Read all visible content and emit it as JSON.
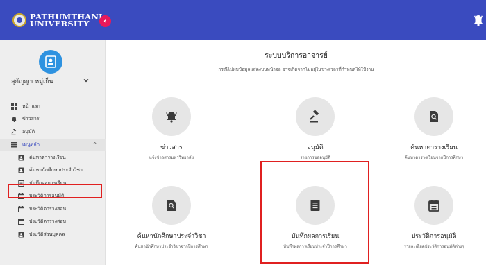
{
  "brand": {
    "line1": "PATHUMTHANI",
    "line2": "UNIVERSITY"
  },
  "header": {
    "toggle_symbol": "‹"
  },
  "user": {
    "name": "สุกัญญา หมู่เย็น"
  },
  "menu": {
    "items": [
      {
        "label": "หน้าแรก"
      },
      {
        "label": "ข่าวสาร"
      },
      {
        "label": "อนุมัติ"
      }
    ],
    "group": {
      "label": "เมนูหลัก",
      "caret": "^"
    },
    "subitems": [
      {
        "label": "ค้นหาตารางเรียน"
      },
      {
        "label": "ค้นหานักศึกษาประจำวิชา"
      },
      {
        "label": "บันทึกผลการเรียน"
      },
      {
        "label": "ประวัติการอนุมัติ"
      },
      {
        "label": "ประวัติตารางสอน"
      },
      {
        "label": "ประวัติตารางสอบ"
      },
      {
        "label": "ประวัติส่วนบุคคล"
      }
    ]
  },
  "main": {
    "title": "ระบบบริการอาจารย์",
    "subtitle": "กรณีไม่พบข้อมูลแสดงบนหน้าจอ อาจเกิดจากไม่อยู่ในช่วงเวลาที่กำหนดให้ใช้งาน",
    "cards": [
      {
        "title": "ข่าวสาร",
        "desc": "แจ้งข่าวสารมหาวิทยาลัย"
      },
      {
        "title": "อนุมัติ",
        "desc": "รายการขออนุมัติ"
      },
      {
        "title": "ค้นหาตารางเรียน",
        "desc": "ค้นหาตารางเรียนจากปีการศึกษา"
      },
      {
        "title": "ค้นหานักศึกษาประจำวิชา",
        "desc": "ค้นหานักศึกษาประจำวิชาจากปีการศึกษา"
      },
      {
        "title": "บันทึกผลการเรียน",
        "desc": "บันทึกผลการเรียนประจำปีการศึกษา"
      },
      {
        "title": "ประวัติการอนุมัติ",
        "desc": "รายละเอียดประวัติการอนุมัติต่างๆ"
      }
    ]
  },
  "colors": {
    "header": "#3a4bbf",
    "accent": "#e8195a",
    "highlight": "#e02020"
  },
  "icons": [
    "bell-icon",
    "gavel-icon",
    "search-doc-icon",
    "list-doc-icon",
    "calendar-icon",
    "user-card-icon"
  ]
}
